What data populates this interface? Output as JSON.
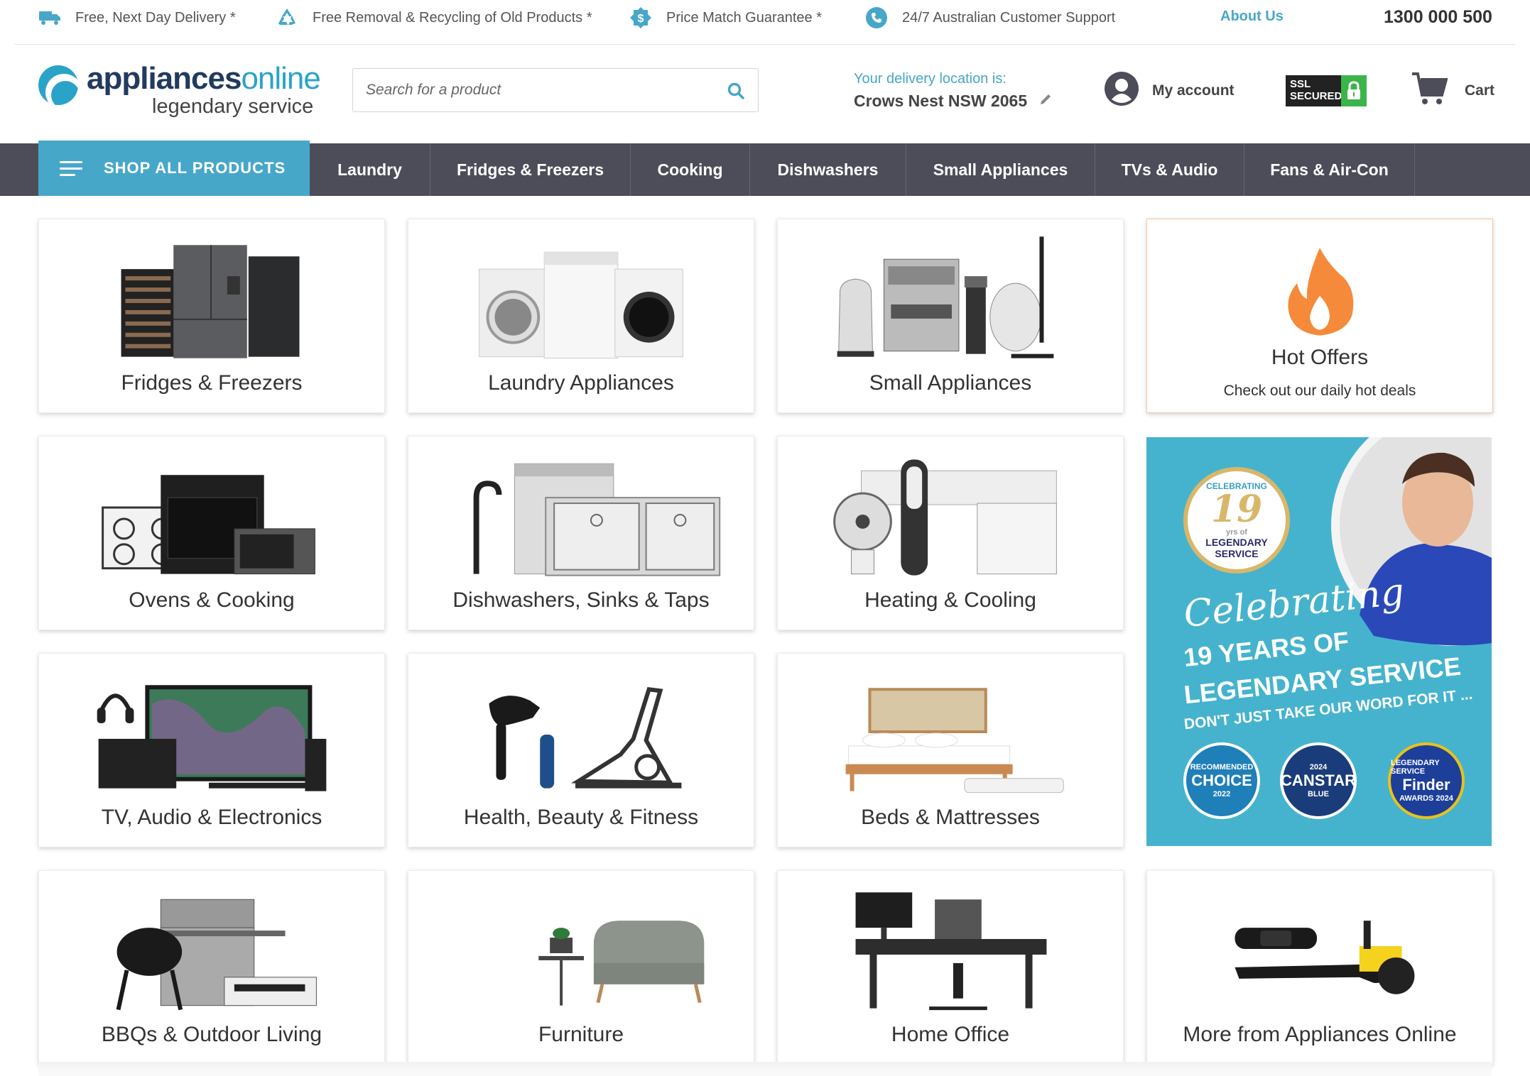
{
  "topbar": {
    "usps": [
      {
        "icon": "truck-icon",
        "label": "Free, Next Day Delivery *"
      },
      {
        "icon": "recycle-icon",
        "label": "Free Removal & Recycling of Old Products *"
      },
      {
        "icon": "dollar-badge-icon",
        "label": "Price Match Guarantee *"
      },
      {
        "icon": "phone-icon",
        "label": "24/7 Australian Customer Support"
      }
    ],
    "about_label": "About Us",
    "phone_number": "1300 000 500"
  },
  "header": {
    "logo_main": "appliances",
    "logo_online": "online",
    "logo_tagline": "legendary service",
    "search_placeholder": "Search for a product",
    "delivery_label": "Your delivery location is:",
    "delivery_location": "Crows Nest NSW 2065",
    "account_label": "My account",
    "ssl_line1": "SSL",
    "ssl_line2": "SECURED",
    "cart_label": "Cart"
  },
  "nav": {
    "shop_all": "SHOP ALL PRODUCTS",
    "items": [
      {
        "label": "Laundry"
      },
      {
        "label": "Fridges & Freezers"
      },
      {
        "label": "Cooking"
      },
      {
        "label": "Dishwashers"
      },
      {
        "label": "Small Appliances"
      },
      {
        "label": "TVs & Audio"
      },
      {
        "label": "Fans & Air-Con"
      }
    ]
  },
  "tiles": [
    {
      "label": "Fridges & Freezers"
    },
    {
      "label": "Laundry Appliances"
    },
    {
      "label": "Small Appliances"
    },
    {
      "label": "Hot Offers",
      "sub": "Check out our daily hot deals"
    },
    {
      "label": "Ovens & Cooking"
    },
    {
      "label": "Dishwashers, Sinks & Taps"
    },
    {
      "label": "Heating & Cooling"
    },
    {
      "label": "TV, Audio & Electronics"
    },
    {
      "label": "Health, Beauty & Fitness"
    },
    {
      "label": "Beds & Mattresses"
    },
    {
      "label": "BBQs & Outdoor Living"
    },
    {
      "label": "Furniture"
    },
    {
      "label": "Home Office"
    },
    {
      "label": "More from Appliances Online"
    }
  ],
  "promo": {
    "seal_top": "CELEBRATING",
    "seal_number": "19",
    "seal_yrs": "yrs of",
    "seal_line1": "LEGENDARY",
    "seal_line2": "SERVICE",
    "celebrating": "Celebrating",
    "line1": "19 YEARS OF",
    "line2": "LEGENDARY SERVICE",
    "line3": "DON'T JUST TAKE OUR WORD FOR IT ...",
    "badges": [
      {
        "top": "RECOMMENDED",
        "big": "CHOICE",
        "small": "2022"
      },
      {
        "top": "2024",
        "big": "CANSTAR",
        "small": "BLUE"
      },
      {
        "top": "LEGENDARY SERVICE",
        "big": "Finder",
        "small": "AWARDS 2024"
      }
    ]
  },
  "colors": {
    "brand_blue": "#47a7c9",
    "nav_bg": "#4d4d5a",
    "hot_orange": "#f58a3a",
    "promo_bg": "#45b3cd",
    "ssl_green": "#3bb54a"
  }
}
